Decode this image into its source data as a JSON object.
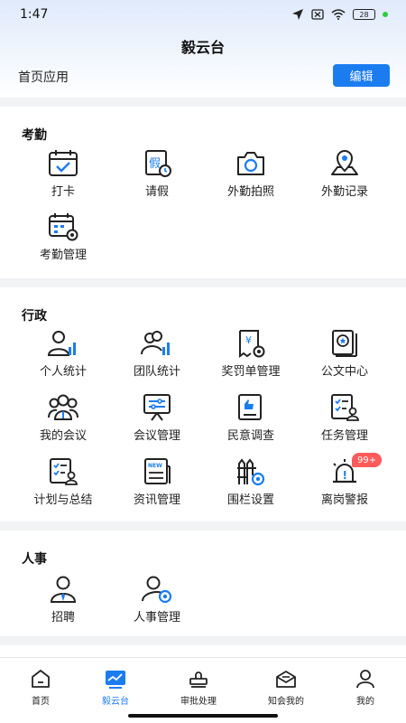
{
  "status_bar": {
    "time": "1:47",
    "battery": "28"
  },
  "header": {
    "title": "毅云台"
  },
  "subheader": {
    "label": "首页应用",
    "edit_label": "编辑"
  },
  "sections": {
    "attendance": {
      "title": "考勤",
      "items": [
        "打卡",
        "请假",
        "外勤拍照",
        "外勤记录",
        "考勤管理"
      ]
    },
    "admin": {
      "title": "行政",
      "items": [
        "个人统计",
        "团队统计",
        "奖罚单管理",
        "公文中心",
        "我的会议",
        "会议管理",
        "民意调查",
        "任务管理",
        "计划与总结",
        "资讯管理",
        "围栏设置",
        "离岗警报"
      ],
      "badge": "99+"
    },
    "hr": {
      "title": "人事",
      "items": [
        "招聘",
        "人事管理"
      ]
    }
  },
  "tabbar": {
    "items": [
      "首页",
      "毅云台",
      "审批处理",
      "知会我的",
      "我的"
    ],
    "active": "毅云台"
  },
  "colors": {
    "accent": "#1b7cf0",
    "badge": "#ff5a5a"
  },
  "icons": {
    "glyph_jia": "假",
    "glyph_yen": "¥",
    "glyph_new": "NEW",
    "glyph_alert": "!"
  }
}
